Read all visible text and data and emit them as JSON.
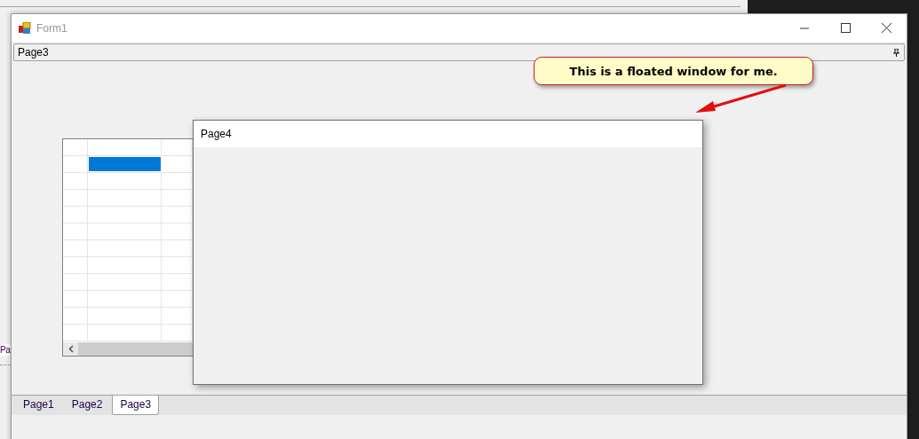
{
  "background_window": {
    "tab_fragment": "Pa"
  },
  "window": {
    "title": "Form1"
  },
  "dock_panel": {
    "title": "Page3",
    "pinned": true
  },
  "grid": {
    "rows": [
      {
        "selected": true
      },
      {
        "selected": false
      },
      {
        "selected": false
      },
      {
        "selected": false
      },
      {
        "selected": false
      },
      {
        "selected": false
      },
      {
        "selected": false
      },
      {
        "selected": false
      },
      {
        "selected": false
      },
      {
        "selected": false
      },
      {
        "selected": false
      }
    ]
  },
  "floating_window": {
    "title": "Page4"
  },
  "callout": {
    "text": "This is a floated window for me."
  },
  "tabs": [
    {
      "label": "Page1",
      "selected": false
    },
    {
      "label": "Page2",
      "selected": false
    },
    {
      "label": "Page3",
      "selected": true
    }
  ]
}
